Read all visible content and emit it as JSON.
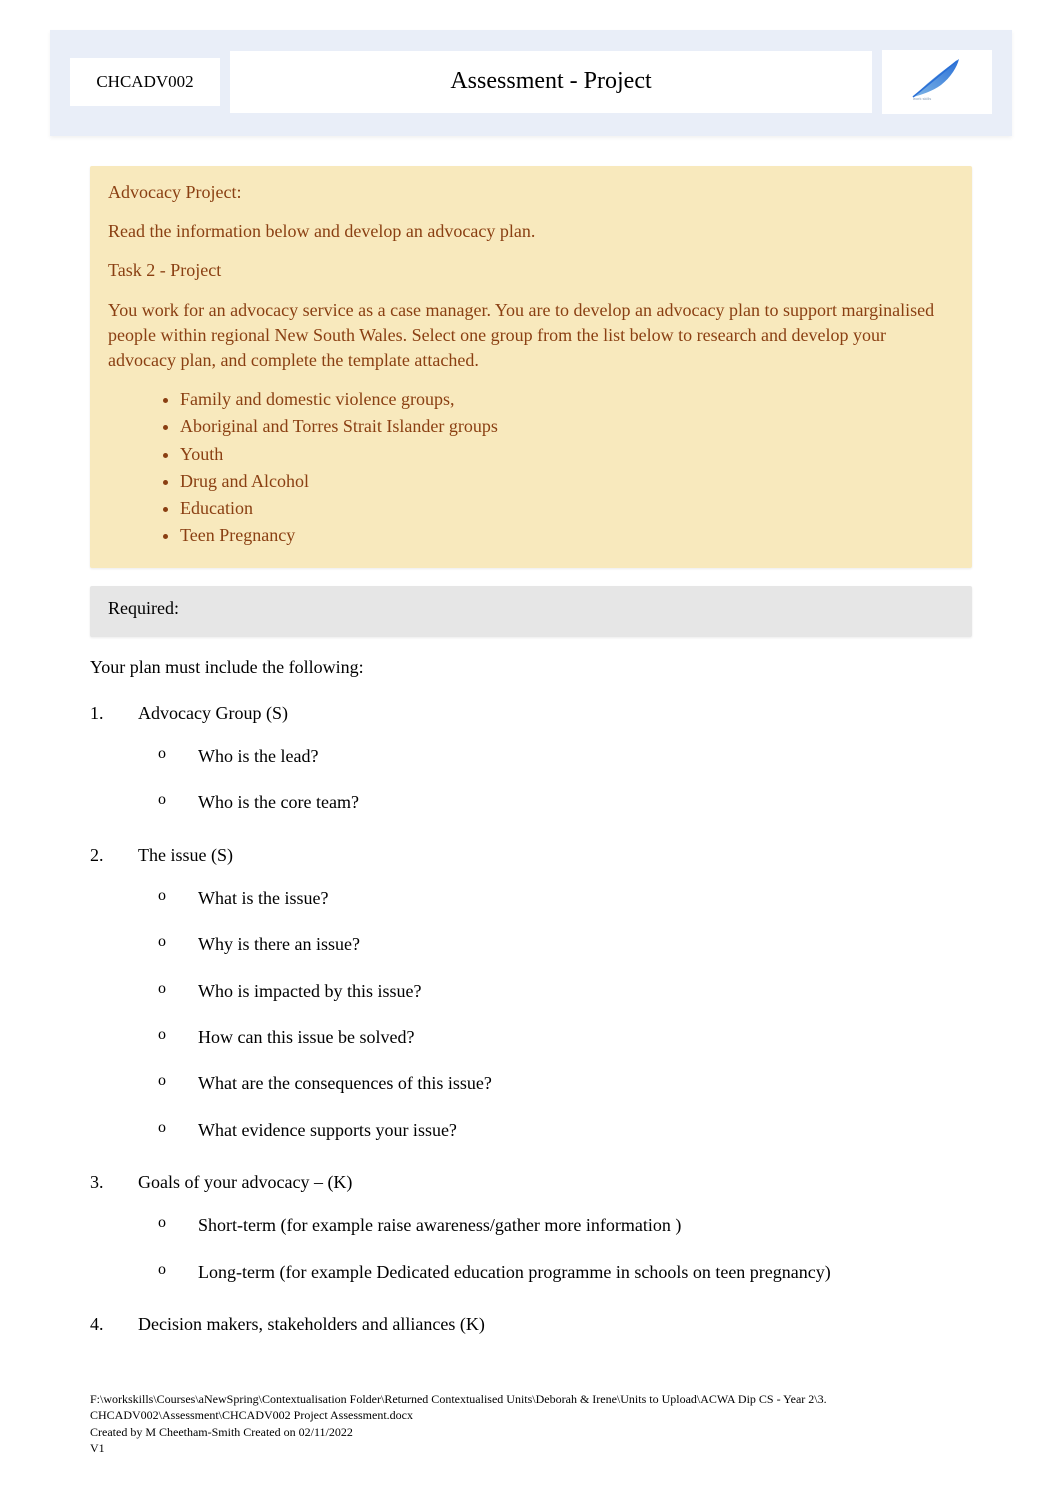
{
  "header": {
    "code": "CHCADV002",
    "title": "Assessment - Project",
    "logo_label": "feather-logo"
  },
  "project_panel": {
    "title": "Advocacy Project:",
    "intro": "Read the information below and develop an advocacy plan.",
    "task_label": "Task 2 - Project",
    "description": "You work for an advocacy service as a case manager. You are to develop an advocacy plan to support marginalised people within regional New South Wales. Select one group from the list below to research and develop your advocacy plan, and complete the template attached.",
    "groups": [
      "Family and domestic violence groups,",
      "Aboriginal and Torres Strait Islander groups",
      "Youth",
      "Drug and Alcohol",
      "Education",
      "Teen Pregnancy"
    ]
  },
  "required": {
    "title": "Required:",
    "intro": "Your plan must include the following:",
    "items": [
      {
        "heading": "Advocacy Group (S)",
        "subs": [
          "Who is the lead?",
          "Who is the core team?"
        ]
      },
      {
        "heading": "The issue (S)",
        "subs": [
          "What is the issue?",
          "Why is there an issue?",
          "Who is impacted by this issue?",
          "How can this issue be solved?",
          "What are the consequences of this issue?",
          "What evidence supports your issue?"
        ]
      },
      {
        "heading": "Goals of your advocacy –  (K)",
        "subs": [
          "Short-term (for example raise awareness/gather more information   )",
          "Long-term (for example Dedicated education programme in schools on teen pregnancy)"
        ]
      },
      {
        "heading": "Decision makers, stakeholders and alliances (K)",
        "subs": []
      }
    ]
  },
  "footer": {
    "line1": "F:\\workskills\\Courses\\aNewSpring\\Contextualisation Folder\\Returned Contextualised Units\\Deborah & Irene\\Units to Upload\\ACWA Dip CS - Year 2\\3. CHCADV002\\Assessment\\CHCADV002 Project Assessment.docx",
    "line2": "Created by M Cheetham-Smith Created on 02/11/2022",
    "line3": "V1"
  }
}
